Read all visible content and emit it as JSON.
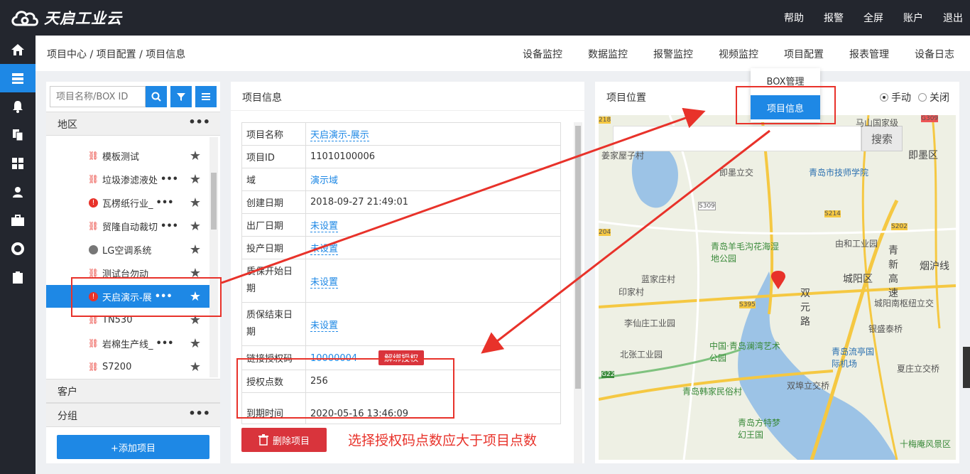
{
  "app": {
    "logo_text": "天启工业云"
  },
  "topnav": [
    "帮助",
    "报警",
    "全屏",
    "账户",
    "退出"
  ],
  "breadcrumb": "项目中心 / 项目配置 / 项目信息",
  "tabs": [
    "设备监控",
    "数据监控",
    "报警监控",
    "视频监控",
    "项目配置",
    "报表管理",
    "设备日志"
  ],
  "dropdown": {
    "item1": "BOX管理",
    "item2": "项目信息"
  },
  "left": {
    "search_placeholder": "项目名称/BOX ID",
    "group_region": "地区",
    "group_customer": "客户",
    "group_group": "分组",
    "more": "•••",
    "add_button": "+添加项目",
    "tree": [
      {
        "label": "模板测试",
        "icon": "unlink",
        "dots": ""
      },
      {
        "label": "垃圾渗滤液处",
        "icon": "unlink",
        "dots": "•••"
      },
      {
        "label": "瓦楞纸行业_",
        "icon": "alert",
        "dots": "•••"
      },
      {
        "label": "贸隆自动裁切",
        "icon": "unlink",
        "dots": "•••"
      },
      {
        "label": "LG空调系统",
        "icon": "offline",
        "dots": ""
      },
      {
        "label": "测试台勿动",
        "icon": "unlink",
        "dots": ""
      },
      {
        "label": "天启演示-展",
        "icon": "alert",
        "dots": "•••",
        "selected": true
      },
      {
        "label": "TN530",
        "icon": "unlink",
        "dots": ""
      },
      {
        "label": "岩棉生产线_",
        "icon": "unlink",
        "dots": "•••"
      },
      {
        "label": "S7200",
        "icon": "unlink",
        "dots": ""
      }
    ]
  },
  "info": {
    "title": "项目信息",
    "rows": {
      "name_k": "项目名称",
      "name_v": "天启演示-展示",
      "id_k": "项目ID",
      "id_v": "11010100006",
      "domain_k": "域",
      "domain_v": "演示域",
      "created_k": "创建日期",
      "created_v": "2018-09-27 21:49:01",
      "factory_k": "出厂日期",
      "factory_v": "未设置",
      "invest_k": "投产日期",
      "invest_v": "未设置",
      "wstart_k": "质保开始日期",
      "wstart_v": "未设置",
      "wend_k": "质保结束日期",
      "wend_v": "未设置",
      "code_k": "链接授权码",
      "code_v": "10000004",
      "unbind": "解绑授权",
      "points_k": "授权点数",
      "points_v": "256",
      "expire_k": "到期时间",
      "expire_v": "2020-05-16 13:46:09"
    },
    "delete_button": "删除项目"
  },
  "location": {
    "title": "项目位置",
    "manual": "手动",
    "off": "关闭",
    "search_button": "搜索",
    "map_labels": [
      "马山国家级",
      "即墨区",
      "即墨立交",
      "青岛市技师学院",
      "由和工业园",
      "青岛羊毛沟花海湿地公园",
      "城阳区",
      "青新高速",
      "烟沪线",
      "蓝家庄村",
      "印家村",
      "双元路",
      "城阳南枢纽立交",
      "李仙庄工业园",
      "银盛泰桥",
      "北张工业园",
      "中国·青岛澜湾艺术公园",
      "青岛流亭国际机场",
      "夏庄立交桥",
      "双埠立交桥",
      "青岛韩家民俗村",
      "青岛方特梦幻王国",
      "十梅庵风景区",
      "姜家屋子村",
      "S309",
      "S214",
      "S202",
      "S395",
      "G22",
      "G309",
      "204",
      "218"
    ]
  },
  "annotation": "选择授权码点数应大于项目点数"
}
